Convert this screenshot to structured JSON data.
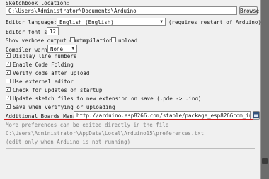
{
  "sketchbook": {
    "label": "Sketchbook location:",
    "path": "C:\\Users\\Administrator\\Documents\\Arduino",
    "browse_label": "Browse"
  },
  "editor_language": {
    "label": "Editor language:",
    "value": "English (English)",
    "note": "(requires restart of Arduino)"
  },
  "editor_font_size": {
    "label": "Editor font size:",
    "value": "12"
  },
  "verbose": {
    "label": "Show verbose output during:",
    "compilation_label": "compilation",
    "compilation_checked": false,
    "upload_label": "upload",
    "upload_checked": false
  },
  "compiler_warnings": {
    "label": "Compiler warnings:",
    "value": "None"
  },
  "options": [
    {
      "label": "Display line numbers",
      "checked": true
    },
    {
      "label": "Enable Code Folding",
      "checked": true
    },
    {
      "label": "Verify code after upload",
      "checked": true
    },
    {
      "label": "Use external editor",
      "checked": false
    },
    {
      "label": "Check for updates on startup",
      "checked": true
    },
    {
      "label": "Update sketch files to new extension on save (.pde -> .ino)",
      "checked": true
    },
    {
      "label": "Save when verifying or uploading",
      "checked": true
    }
  ],
  "boards_manager": {
    "label": "Additional Boards Manager URLs:",
    "value": "http://arduino.esp8266.com/stable/package_esp8266com_index.json",
    "highlight_color": "#d11a1a"
  },
  "footer": {
    "more_prefs": "More preferences can be edited directly in the file",
    "prefs_path": "C:\\Users\\Administrator\\AppData\\Local\\Arduino15\\preferences.txt",
    "edit_note": "(edit only when Arduino is not running)"
  }
}
